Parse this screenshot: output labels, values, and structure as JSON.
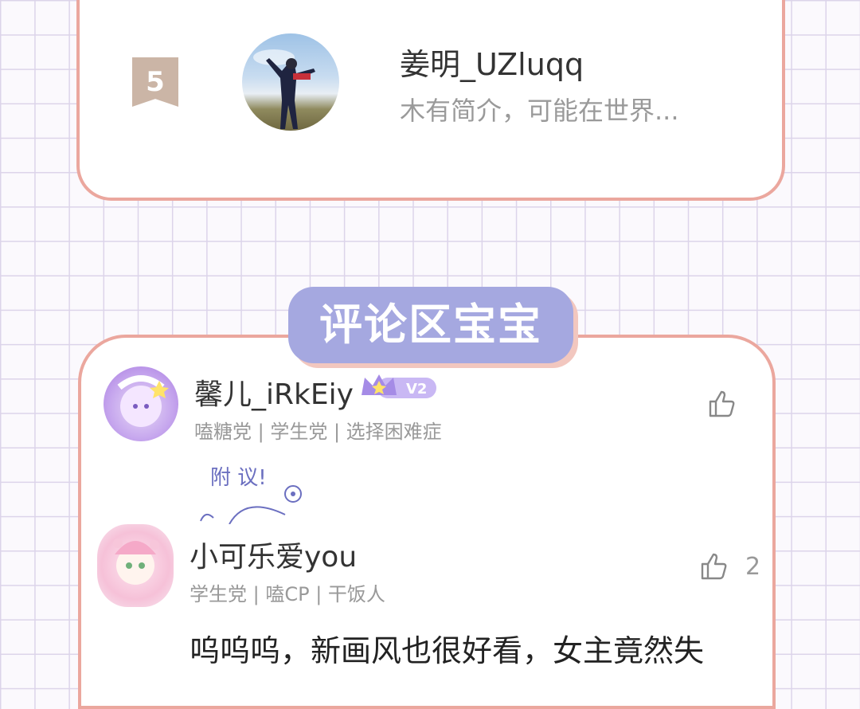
{
  "ranking": {
    "rank": "5",
    "username": "姜明_UZluqq",
    "bio": "木有简介，可能在世界..."
  },
  "section": {
    "title": "评论区宝宝"
  },
  "comments": [
    {
      "username": "馨儿_iRkEiy",
      "vip": "V2",
      "tags": "嗑糖党 | 学生党 | 选择困难症",
      "likes": ""
    },
    {
      "username": "小可乐爱you",
      "tags": "学生党 | 嗑CP | 干饭人",
      "likes": "2",
      "text": "呜呜呜，新画风也很好看，女主竟然失"
    }
  ],
  "decoration": {
    "text": "附 议!"
  },
  "colors": {
    "card_border": "#eba79e",
    "tab_bg": "#a5a8e0",
    "badge": "#cbb5a6",
    "vip": "#a58be6"
  }
}
